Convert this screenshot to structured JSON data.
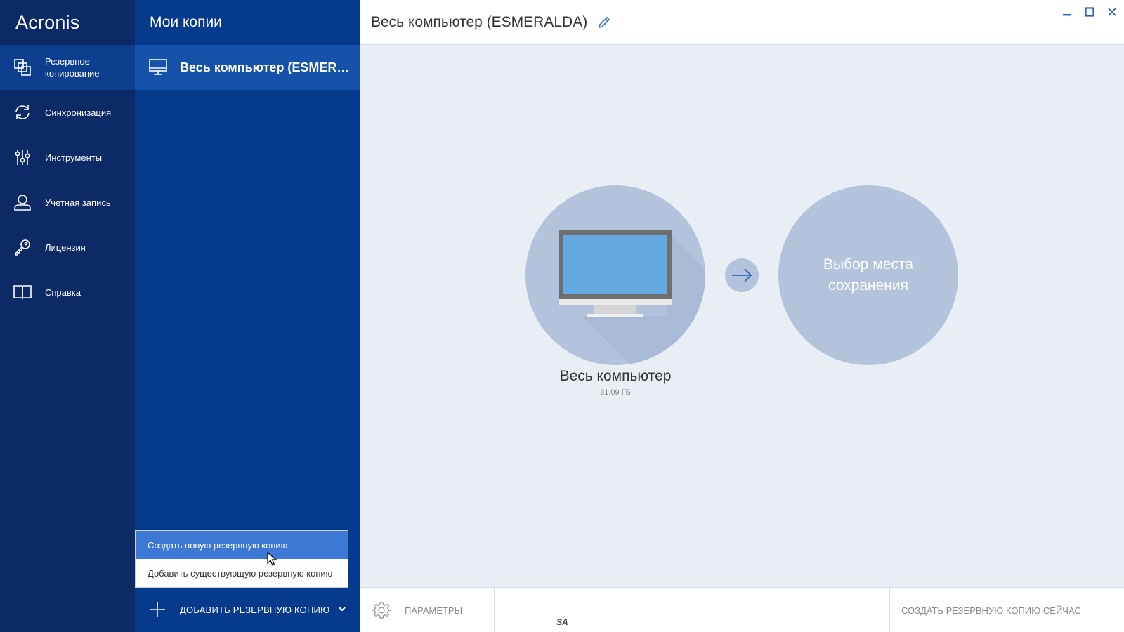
{
  "app": {
    "logo": "Acronis"
  },
  "nav": {
    "items": [
      {
        "label": "Резервное копирование",
        "icon": "backup-icon",
        "active": true
      },
      {
        "label": "Синхронизация",
        "icon": "sync-icon"
      },
      {
        "label": "Инструменты",
        "icon": "tools-icon"
      },
      {
        "label": "Учетная запись",
        "icon": "account-icon"
      },
      {
        "label": "Лицензия",
        "icon": "key-icon"
      },
      {
        "label": "Справка",
        "icon": "book-icon"
      }
    ]
  },
  "panel": {
    "title": "Мои копии",
    "selected_item": "Весь компьютер (ESMERALDA)",
    "dropdown": {
      "items": [
        "Создать новую резервную копию",
        "Добавить существующую резервную копию"
      ]
    },
    "add_button_label": "ДОБАВИТЬ РЕЗЕРВНУЮ КОПИЮ"
  },
  "main": {
    "title": "Весь компьютер (ESMERALDA)",
    "source": {
      "label": "Весь компьютер",
      "size": "31,09 ГБ"
    },
    "destination": {
      "label": "Выбор места сохранения"
    }
  },
  "bottom": {
    "params_label": "ПАРАМЕТРЫ",
    "create_now_label": "СОЗДАТЬ РЕЗЕРВНУЮ КОПИЮ СЕЙЧАС",
    "mark": "SA"
  },
  "colors": {
    "nav_bg": "#0b2a66",
    "panel_bg": "#053a8c",
    "selected_bg": "#1652a9",
    "main_bg": "#e9edf4",
    "circle": "#b3c3dc",
    "dropdown_hover": "#3d78d4"
  }
}
